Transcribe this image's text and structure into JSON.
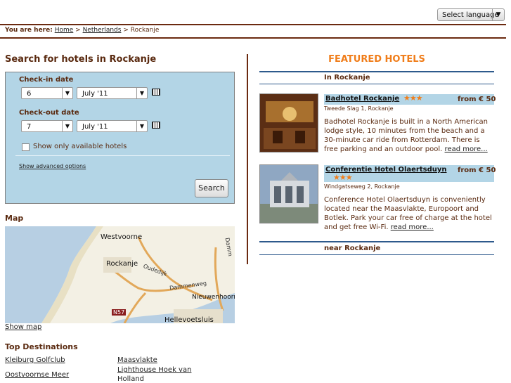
{
  "language_select": {
    "label": "Select language"
  },
  "breadcrumb": {
    "prefix": "You are here:",
    "home": "Home",
    "country": "Netherlands",
    "current": "Rockanje",
    "sep": ">"
  },
  "search": {
    "title": "Search for hotels in Rockanje",
    "checkin_label": "Check-in date",
    "checkin_day": "6",
    "checkin_month": "July '11",
    "checkout_label": "Check-out date",
    "checkout_day": "7",
    "checkout_month": "July '11",
    "available_only_label": "Show only available hotels",
    "advanced_link": "Show advanced options",
    "search_button": "Search"
  },
  "map": {
    "title": "Map",
    "show_link": "Show map",
    "labels": {
      "westvoorne": "Westvoorne",
      "rockanje": "Rockanje",
      "oudedijk": "Oudedijk",
      "dammenweg": "Dammenweg",
      "nieuwenhoorn": "Nieuwenhoorn",
      "hellevoetsluis": "Hellevoetsluis",
      "n57": "N57",
      "damm": "Damm"
    }
  },
  "top_destinations": {
    "title": "Top Destinations",
    "items": [
      "Kleiburg Golfclub",
      "Maasvlakte",
      "Oostvoornse Meer",
      "Lighthouse Hoek van",
      "Holland"
    ]
  },
  "featured": {
    "title": "FEATURED HOTELS",
    "in_label": "In Rockanje",
    "near_label": "near Rockanje",
    "hotels": [
      {
        "name": "Badhotel Rockanje",
        "stars": "★★★",
        "price": "from € 50",
        "address": "Tweede Slag 1, Rockanje",
        "description": "Badhotel Rockanje is built in a North American lodge style, 10 minutes from the beach and a 30-minute car ride from Rotterdam. There is free parking and an outdoor pool.",
        "more": "read more..."
      },
      {
        "name": "Conferentie Hotel Olaertsduyn",
        "stars": "★★★",
        "price": "from € 50",
        "address": "Windgatseweg 2, Rockanje",
        "description": "Conference Hotel Olaertsduyn is conveniently located near the Maasvlakte, Europoort and Botlek. Park your car free of charge at the hotel and get free Wi-Fi.",
        "more": "read more..."
      }
    ]
  },
  "colors": {
    "brown": "#5a2a10",
    "orange": "#f07d1a",
    "light_blue": "#b3d5e6",
    "dark_blue": "#2e5a8c"
  }
}
